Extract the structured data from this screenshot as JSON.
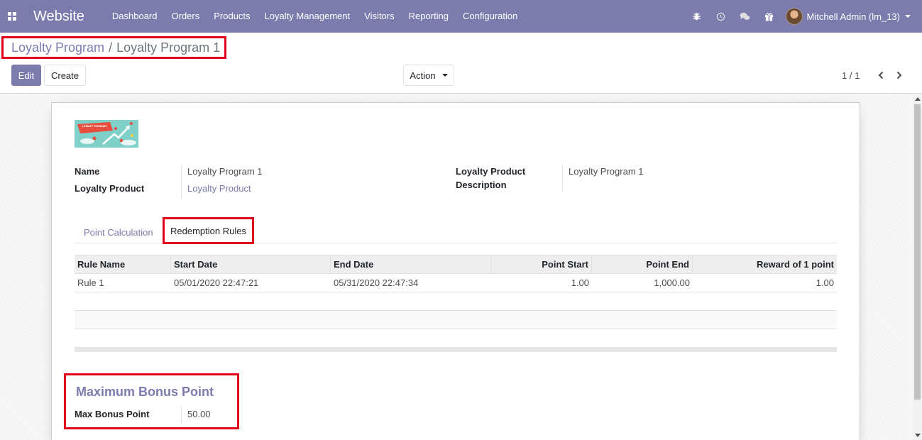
{
  "navbar": {
    "brand": "Website",
    "menu": [
      "Dashboard",
      "Orders",
      "Products",
      "Loyalty Management",
      "Visitors",
      "Reporting",
      "Configuration"
    ],
    "user": "Mitchell Admin (lm_13)",
    "bg_color": "#7c7bad"
  },
  "breadcrumb": {
    "parent": "Loyalty Program",
    "separator": "/",
    "current": "Loyalty Program 1"
  },
  "buttons": {
    "edit": "Edit",
    "create": "Create",
    "action": "Action"
  },
  "pager": {
    "value": "1 / 1"
  },
  "form": {
    "image_text": "LOYALTY PROGRAM",
    "name_label": "Name",
    "name_value": "Loyalty Program 1",
    "product_label": "Loyalty Product",
    "product_value": "Loyalty Product",
    "desc_label_line1": "Loyalty Product",
    "desc_label_line2": "Description",
    "desc_value": "Loyalty Program 1"
  },
  "tabs": {
    "point_calc": "Point Calculation",
    "redemption": "Redemption Rules"
  },
  "table": {
    "headers": [
      "Rule Name",
      "Start Date",
      "End Date",
      "Point Start",
      "Point End",
      "Reward of 1 point"
    ],
    "rows": [
      [
        "Rule 1",
        "05/01/2020 22:47:21",
        "05/31/2020 22:47:34",
        "1.00",
        "1,000.00",
        "1.00"
      ]
    ]
  },
  "bonus": {
    "title": "Maximum Bonus Point",
    "label": "Max Bonus Point",
    "value": "50.00"
  },
  "colors": {
    "accent": "#7c7bad",
    "highlight": "#e0001b"
  }
}
